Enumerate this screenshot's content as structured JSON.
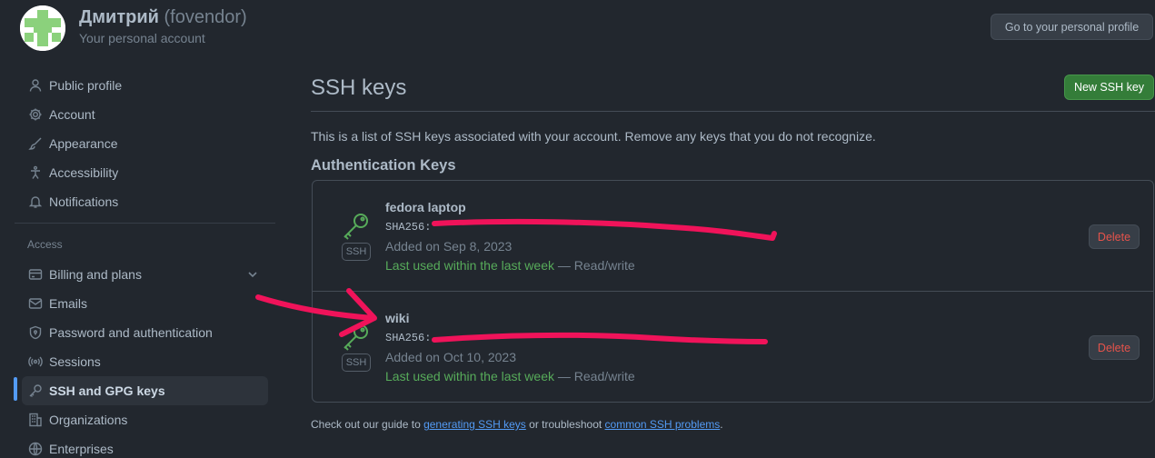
{
  "header": {
    "display_name": "Дмитрий",
    "login": "(fovendor)",
    "subtitle": "Your personal account",
    "profile_button": "Go to your personal profile"
  },
  "sidebar": {
    "items_top": [
      {
        "label": "Public profile",
        "icon": "person-icon"
      },
      {
        "label": "Account",
        "icon": "gear-icon"
      },
      {
        "label": "Appearance",
        "icon": "paintbrush-icon"
      },
      {
        "label": "Accessibility",
        "icon": "accessibility-icon"
      },
      {
        "label": "Notifications",
        "icon": "bell-icon"
      }
    ],
    "access_heading": "Access",
    "items_access": [
      {
        "label": "Billing and plans",
        "icon": "credit-card-icon"
      },
      {
        "label": "Emails",
        "icon": "mail-icon"
      },
      {
        "label": "Password and authentication",
        "icon": "shield-lock-icon"
      },
      {
        "label": "Sessions",
        "icon": "broadcast-icon"
      },
      {
        "label": "SSH and GPG keys",
        "icon": "key-icon",
        "selected": true
      },
      {
        "label": "Organizations",
        "icon": "organization-icon"
      },
      {
        "label": "Enterprises",
        "icon": "globe-icon"
      }
    ]
  },
  "main": {
    "title": "SSH keys",
    "new_button": "New SSH key",
    "description": "This is a list of SSH keys associated with your account. Remove any keys that you do not recognize.",
    "auth_heading": "Authentication Keys",
    "keys": [
      {
        "name": "fedora laptop",
        "fingerprint_label": "SHA256:",
        "added": "Added on Sep 8, 2023",
        "last_used": "Last used within the last week",
        "access": " — Read/write",
        "badge": "SSH",
        "delete_label": "Delete"
      },
      {
        "name": "wiki",
        "fingerprint_label": "SHA256:",
        "added": "Added on Oct 10, 2023",
        "last_used": "Last used within the last week",
        "access": " — Read/write",
        "badge": "SSH",
        "delete_label": "Delete"
      }
    ],
    "footer": {
      "prefix": "Check out our guide to ",
      "link1": "generating SSH keys",
      "middle": " or troubleshoot ",
      "link2": "common SSH problems",
      "suffix": "."
    }
  },
  "colors": {
    "background": "#22272e",
    "accent_green": "#57ab5a",
    "link_blue": "#539bf5",
    "danger_red": "#e5534b",
    "annotation_red": "#f0135a"
  }
}
